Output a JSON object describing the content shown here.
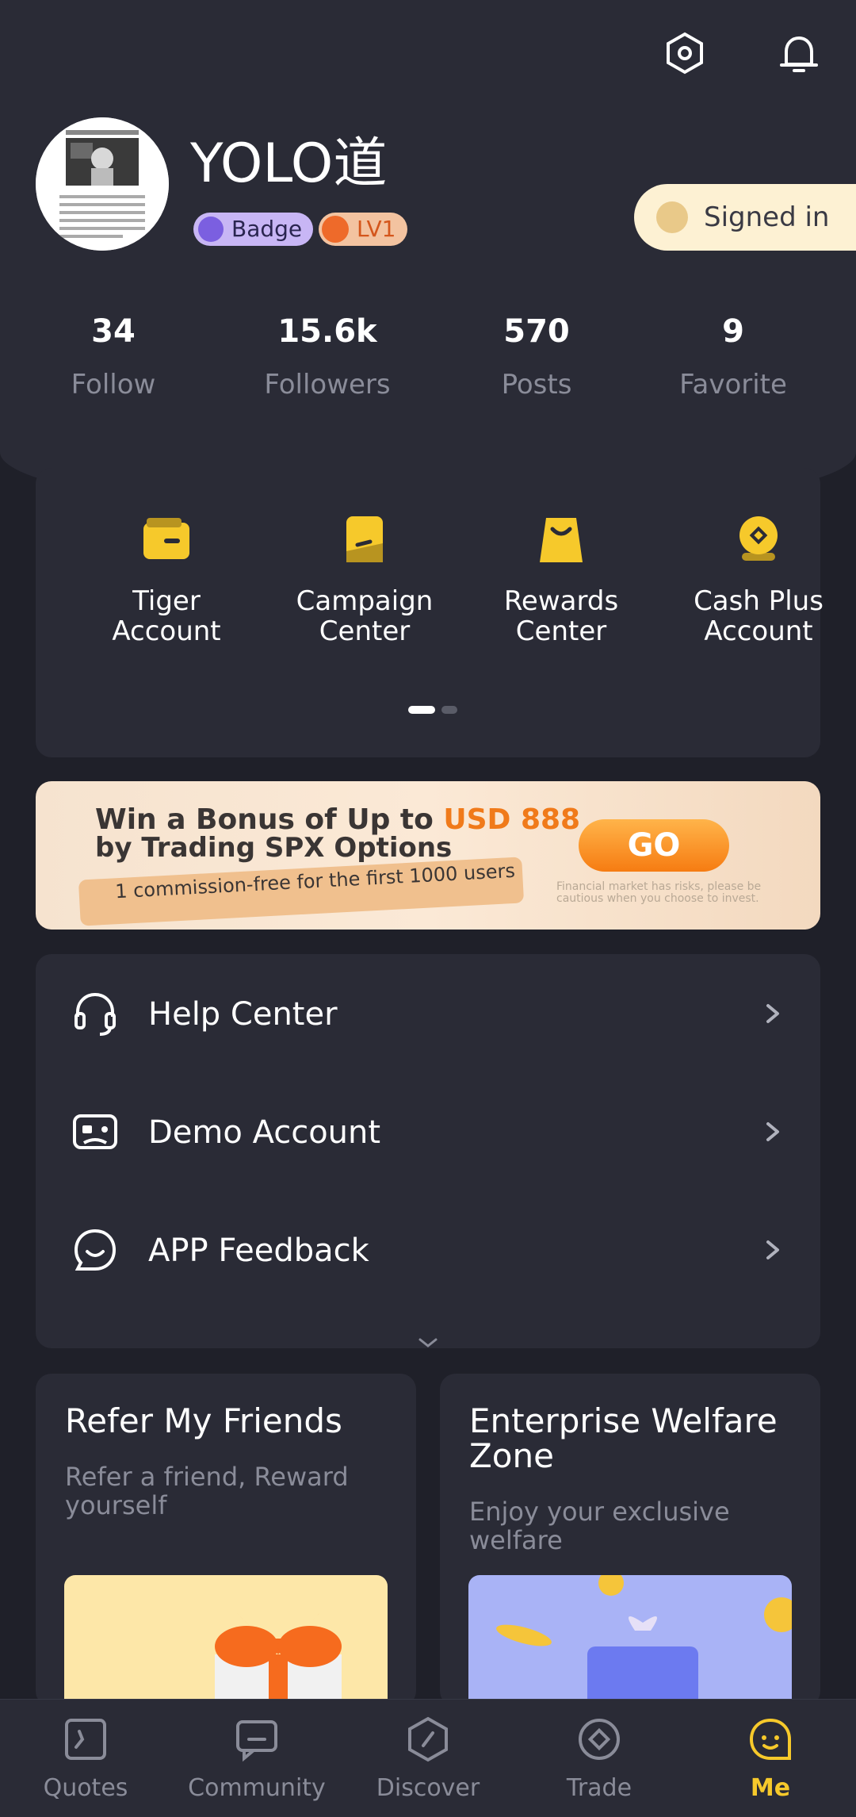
{
  "header": {
    "username": "YOLO道",
    "badge_label": "Badge",
    "level_label": "LV1",
    "signin_label": "Signed in"
  },
  "stats": [
    {
      "value": "34",
      "label": "Follow"
    },
    {
      "value": "15.6k",
      "label": "Followers"
    },
    {
      "value": "570",
      "label": "Posts"
    },
    {
      "value": "9",
      "label": "Favorite"
    }
  ],
  "shortcuts": [
    {
      "line1": "Tiger",
      "line2": "Account",
      "icon": "wallet-icon"
    },
    {
      "line1": "Campaign",
      "line2": "Center",
      "icon": "flag-icon"
    },
    {
      "line1": "Rewards",
      "line2": "Center",
      "icon": "shopping-bag-icon"
    },
    {
      "line1": "Cash Plus",
      "line2": "Account",
      "icon": "coin-icon"
    }
  ],
  "banner": {
    "line1_prefix": "Win a Bonus of Up to ",
    "line1_highlight": "USD 888",
    "line2": "by Trading SPX Options",
    "ribbon_text": "1 commission-free for the first 1000 users",
    "go_label": "GO",
    "risk_text": "Financial market has risks, please be cautious when you choose to invest."
  },
  "menu": [
    {
      "label": "Help Center",
      "icon": "headset-icon"
    },
    {
      "label": "Demo Account",
      "icon": "gamepad-icon"
    },
    {
      "label": "APP Feedback",
      "icon": "smile-chat-icon"
    }
  ],
  "promos": [
    {
      "title": "Refer My Friends",
      "subtitle": "Refer a friend, Reward yourself"
    },
    {
      "title": "Enterprise Welfare Zone",
      "subtitle": "Enjoy your exclusive welfare"
    }
  ],
  "tabs": [
    {
      "label": "Quotes",
      "icon": "chart-icon"
    },
    {
      "label": "Community",
      "icon": "chat-icon"
    },
    {
      "label": "Discover",
      "icon": "compass-icon"
    },
    {
      "label": "Trade",
      "icon": "trade-icon"
    },
    {
      "label": "Me",
      "icon": "face-icon",
      "active": true
    }
  ],
  "colors": {
    "background": "#1f2029",
    "card": "#2a2b36",
    "accent": "#f6c92b",
    "muted_text": "#8a8c99"
  }
}
